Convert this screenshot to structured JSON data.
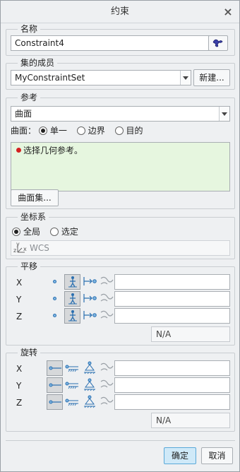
{
  "dialog": {
    "title": "约束",
    "close_glyph": "×"
  },
  "name_group": {
    "label": "名称",
    "value": "Constraint4"
  },
  "set_group": {
    "label": "集的成员",
    "selected": "MyConstraintSet",
    "new_button": "新建..."
  },
  "ref_group": {
    "label": "参考",
    "type_selected": "曲面",
    "surface_label": "曲面：",
    "options": [
      "单一",
      "边界",
      "目的"
    ],
    "selected_option": 0,
    "message": "选择几何参考。",
    "surface_set_button": "曲面集..."
  },
  "coord_group": {
    "label": "坐标系",
    "options": [
      "全局",
      "选定"
    ],
    "selected_option": 0,
    "csys_axis_y": "y",
    "csys_axis_z": "z",
    "csys_axis_x": "x",
    "csys_value": "WCS"
  },
  "translation_group": {
    "label": "平移",
    "axes": [
      "X",
      "Y",
      "Z"
    ],
    "combined_value": "N/A"
  },
  "rotation_group": {
    "label": "旋转",
    "axes": [
      "X",
      "Y",
      "Z"
    ],
    "combined_value": "N/A"
  },
  "footer": {
    "ok": "确定",
    "cancel": "取消"
  },
  "colors": {
    "accent": "#5aa9d8",
    "message_bg": "#e6f6df",
    "error_dot": "#d42020",
    "icon_blue": "#2a6fb0"
  }
}
